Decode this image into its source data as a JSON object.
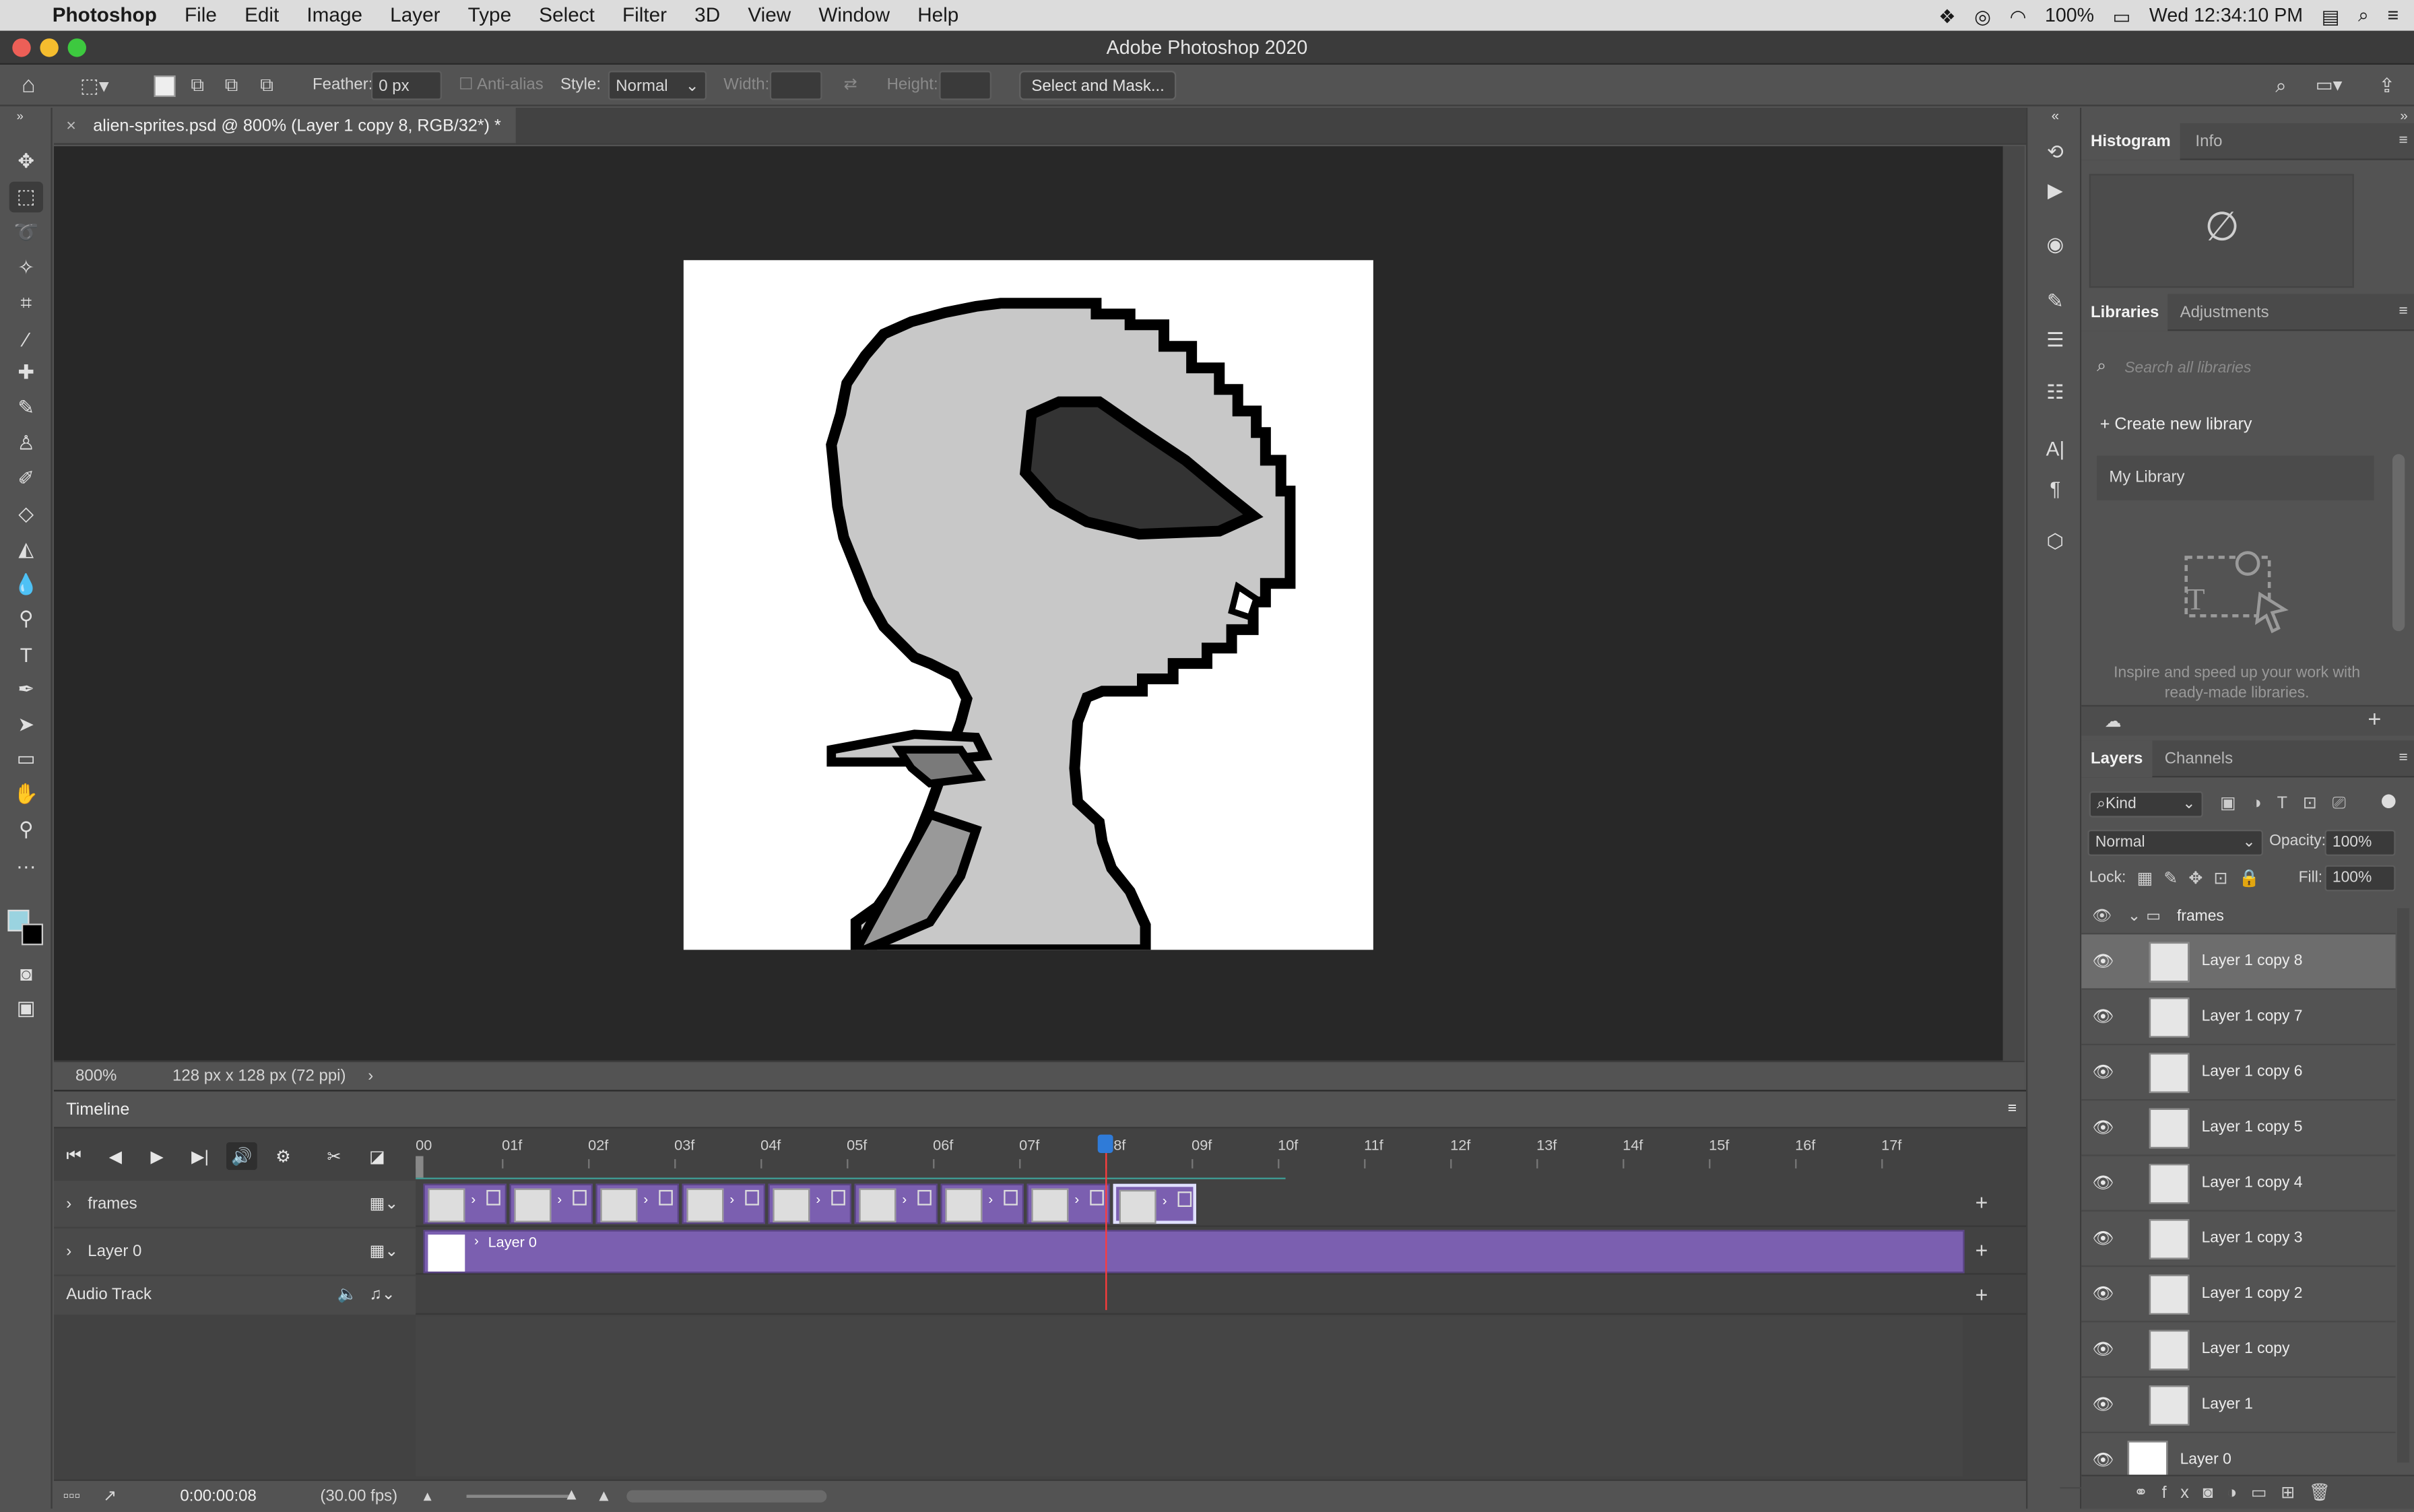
{
  "menubar": {
    "app": "Photoshop",
    "items": [
      "File",
      "Edit",
      "Image",
      "Layer",
      "Type",
      "Select",
      "Filter",
      "3D",
      "View",
      "Window",
      "Help"
    ],
    "battery": "100%",
    "clock": "Wed 12:34:10 PM"
  },
  "window": {
    "title": "Adobe Photoshop 2020"
  },
  "options": {
    "feather_label": "Feather:",
    "feather_value": "0 px",
    "antialias": "Anti-alias",
    "style_label": "Style:",
    "style_value": "Normal",
    "width_label": "Width:",
    "height_label": "Height:",
    "select_mask": "Select and Mask..."
  },
  "document": {
    "tab_title": "alien-sprites.psd @ 800% (Layer 1 copy 8, RGB/32*) *",
    "zoom": "800%",
    "info": "128 px x 128 px (72 ppi)"
  },
  "timeline": {
    "title": "Timeline",
    "ticks": [
      "00",
      "01f",
      "02f",
      "03f",
      "04f",
      "05f",
      "06f",
      "07f",
      "08f",
      "09f",
      "10f",
      "11f",
      "12f",
      "13f",
      "14f",
      "15f",
      "16f",
      "17f"
    ],
    "playhead_frame": 8,
    "tracks": {
      "frames": "frames",
      "layer0": "Layer 0",
      "layer0_clip": "Layer 0",
      "audio": "Audio Track"
    },
    "clip_count": 9,
    "timecode": "0:00:00:08",
    "fps": "(30.00 fps)"
  },
  "panels": {
    "histogram_tab": "Histogram",
    "info_tab": "Info",
    "libraries_tab": "Libraries",
    "adjustments_tab": "Adjustments",
    "search_placeholder": "Search all libraries",
    "create_library": "Create new library",
    "my_library": "My Library",
    "inspire_text": "Inspire and speed up your work with ready-made libraries.",
    "layers_tab": "Layers",
    "channels_tab": "Channels",
    "kind": "Kind",
    "blend_mode": "Normal",
    "opacity_label": "Opacity:",
    "opacity_value": "100%",
    "lock_label": "Lock:",
    "fill_label": "Fill:",
    "fill_value": "100%"
  },
  "layers": {
    "group": "frames",
    "items": [
      "Layer 1 copy 8",
      "Layer 1 copy 7",
      "Layer 1 copy 6",
      "Layer 1 copy 5",
      "Layer 1 copy 4",
      "Layer 1 copy 3",
      "Layer 1 copy 2",
      "Layer 1 copy",
      "Layer 1",
      "Layer 0"
    ],
    "selected_index": 0
  }
}
